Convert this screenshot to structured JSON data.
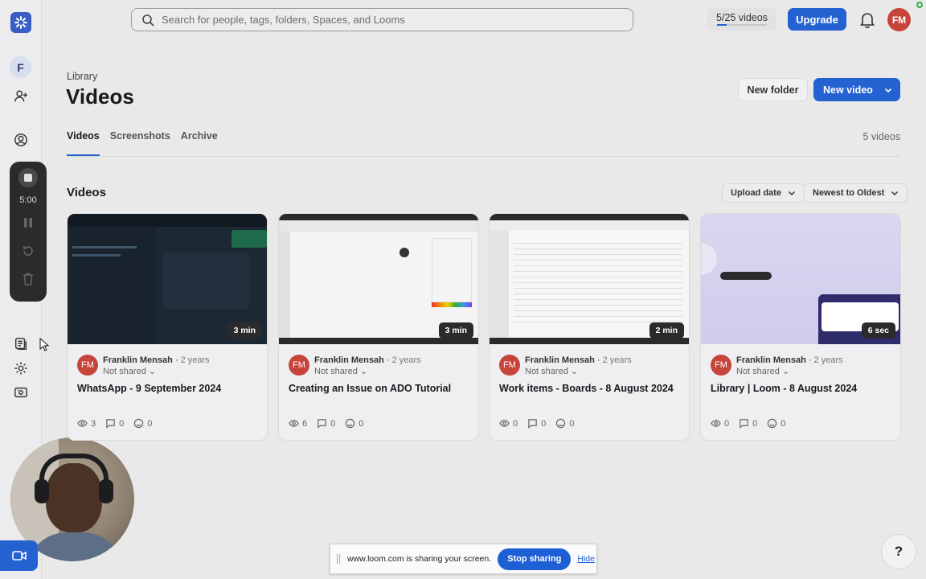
{
  "search": {
    "placeholder": "Search for people, tags, folders, Spaces, and Looms"
  },
  "topbar": {
    "video_count": "5/25 videos",
    "video_quota": 0.2,
    "upgrade": "Upgrade",
    "avatar": "FM"
  },
  "workspace": {
    "initial": "F"
  },
  "recorder": {
    "time": "5:00"
  },
  "header": {
    "breadcrumb": "Library",
    "title": "Videos",
    "new_folder": "New folder",
    "new_video": "New video"
  },
  "tabs": [
    "Videos",
    "Screenshots",
    "Archive"
  ],
  "total": "5 videos",
  "section": {
    "title": "Videos",
    "sort_field": "Upload date",
    "sort_order": "Newest to Oldest"
  },
  "cards": [
    {
      "duration": "3 min",
      "avatar": "FM",
      "owner": "Franklin Mensah",
      "age": "2 years",
      "sharing": "Not shared",
      "title": "WhatsApp - 9 September 2024",
      "views": "3",
      "comments": "0",
      "reactions": "0"
    },
    {
      "duration": "3 min",
      "avatar": "FM",
      "owner": "Franklin Mensah",
      "age": "2 years",
      "sharing": "Not shared",
      "title": "Creating an Issue on ADO Tutorial",
      "views": "6",
      "comments": "0",
      "reactions": "0"
    },
    {
      "duration": "2 min",
      "avatar": "FM",
      "owner": "Franklin Mensah",
      "age": "2 years",
      "sharing": "Not shared",
      "title": "Work items - Boards - 8 August 2024",
      "views": "0",
      "comments": "0",
      "reactions": "0"
    },
    {
      "duration": "6 sec",
      "avatar": "FM",
      "owner": "Franklin Mensah",
      "age": "2 years",
      "sharing": "Not shared",
      "title": "Library | Loom - 8 August 2024",
      "views": "0",
      "comments": "0",
      "reactions": "0"
    }
  ],
  "share_banner": {
    "text": "www.loom.com is sharing your screen.",
    "stop": "Stop sharing",
    "hide": "Hide"
  },
  "help": "?",
  "colors": {
    "accent": "#2462d1",
    "avatar": "#c6443a"
  }
}
